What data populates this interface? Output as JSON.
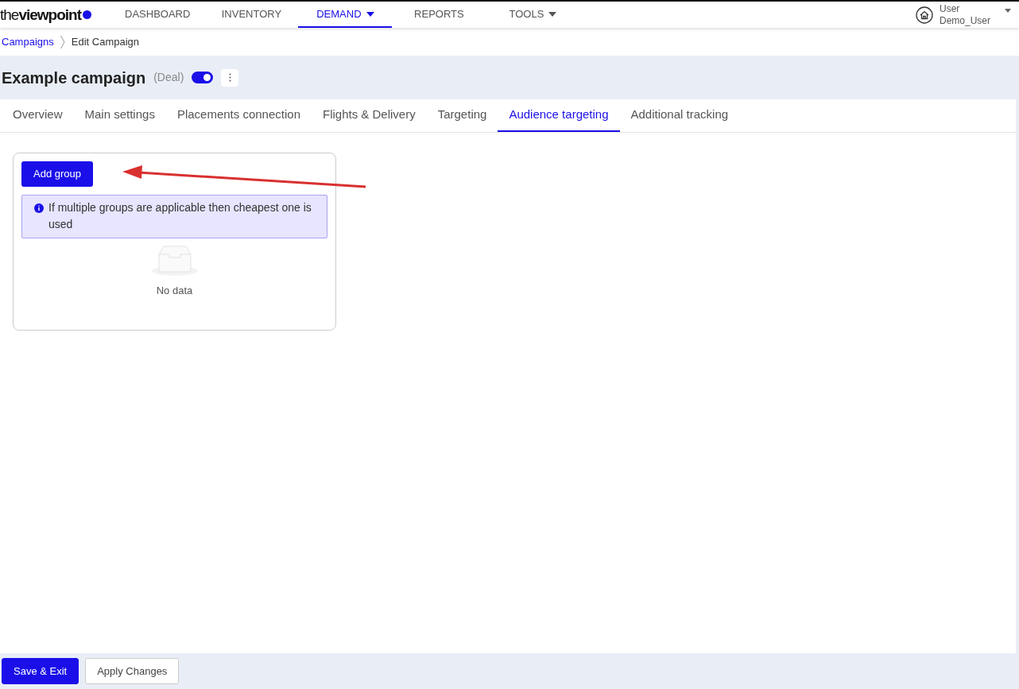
{
  "brand": {
    "text_light": "the",
    "text_bold": "viewpoint"
  },
  "nav_items": [
    {
      "label": "DASHBOARD",
      "selected": false,
      "dropdown": false
    },
    {
      "label": "INVENTORY",
      "selected": false,
      "dropdown": false
    },
    {
      "label": "DEMAND",
      "selected": true,
      "dropdown": true
    },
    {
      "label": "REPORTS",
      "selected": false,
      "dropdown": false
    },
    {
      "label": "TOOLS",
      "selected": false,
      "dropdown": true
    }
  ],
  "user": {
    "role": "User",
    "name": "Demo_User"
  },
  "breadcrumb": [
    {
      "label": "Campaigns",
      "link": true
    },
    {
      "label": "Edit Campaign",
      "link": false
    }
  ],
  "campaign": {
    "title": "Example campaign",
    "type": "(Deal)",
    "enabled": true
  },
  "tabs": [
    {
      "label": "Overview",
      "selected": false
    },
    {
      "label": "Main settings",
      "selected": false
    },
    {
      "label": "Placements connection",
      "selected": false
    },
    {
      "label": "Flights & Delivery",
      "selected": false
    },
    {
      "label": "Targeting",
      "selected": false
    },
    {
      "label": "Audience targeting",
      "selected": true
    },
    {
      "label": "Additional tracking",
      "selected": false
    }
  ],
  "panel": {
    "add_button": "Add group",
    "info": "If multiple groups are applicable then cheapest one is used",
    "empty_text": "No data"
  },
  "annotation_arrow": true,
  "footer_buttons": [
    {
      "label": "Save & Exit",
      "kind": "primary"
    },
    {
      "label": "Apply Changes",
      "kind": "secondary"
    }
  ]
}
